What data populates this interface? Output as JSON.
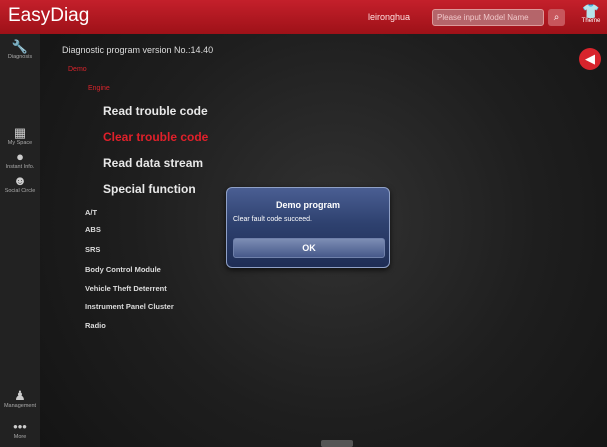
{
  "header": {
    "app_title": "EasyDiag",
    "username": "leironghua",
    "search_placeholder": "Please input Model Name",
    "search_icon": "magnifier-icon",
    "theme_label": "Theme",
    "theme_icon": "shirt-icon"
  },
  "sidebar": {
    "items": [
      {
        "label": "Diagnosis",
        "icon": "wrench-icon",
        "glyph": "🔧"
      },
      {
        "label": "My Space",
        "icon": "calendar-icon",
        "glyph": "▦"
      },
      {
        "label": "Instant Info.",
        "icon": "chat-bubble-icon",
        "glyph": "●"
      },
      {
        "label": "Social Circle",
        "icon": "smiley-icon",
        "glyph": "☻"
      },
      {
        "label": "Management",
        "icon": "person-icon",
        "glyph": "♟"
      },
      {
        "label": "More",
        "icon": "ellipsis-icon",
        "glyph": "•••"
      }
    ]
  },
  "main": {
    "version_text": "Diagnostic program version No.:14.40",
    "breadcrumb": [
      "Demo",
      "Engine"
    ],
    "functions": [
      {
        "label": "Read trouble code"
      },
      {
        "label": "Clear trouble code"
      },
      {
        "label": "Read data stream"
      },
      {
        "label": "Special function"
      }
    ],
    "active_function": "Clear trouble code",
    "systems": [
      {
        "label": "A/T"
      },
      {
        "label": "ABS"
      },
      {
        "label": "SRS"
      },
      {
        "label": "Body Control Module"
      },
      {
        "label": "Vehicle Theft Deterrent"
      },
      {
        "label": "Instrument Panel Cluster"
      },
      {
        "label": "Radio"
      }
    ]
  },
  "dialog": {
    "title": "Demo program",
    "message": "Clear fault code succeed.",
    "ok_label": "OK"
  },
  "colors": {
    "brand_red": "#c4202b",
    "active_red": "#e0202a",
    "dialog_blue": "#2e416f"
  }
}
